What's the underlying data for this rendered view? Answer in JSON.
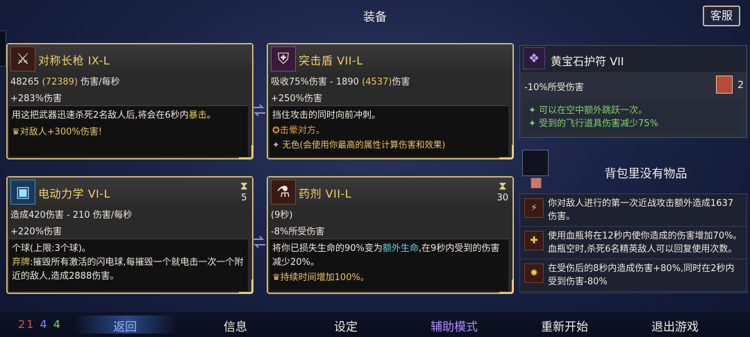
{
  "header": {
    "title": "装备",
    "customer_service": "客服"
  },
  "cards": {
    "weapon": {
      "name": "对称长枪  IX-L",
      "stat1_value": "48265",
      "stat1_paren": "(72389)",
      "stat1_unit": "伤害/每秒",
      "stat2": "+283%伤害",
      "desc_a": "用这把武器迅速杀死2名敌人后,将会在6秒内",
      "desc_highlight": "暴击",
      "desc_end": "。",
      "bonus": "对敌人+300%伤害!"
    },
    "shield": {
      "name": "突击盾  VII-L",
      "stat1_a": "吸收75%伤害  -  1890",
      "stat1_paren": "(4537)",
      "stat1_unit": "伤害",
      "stat2": "+250%伤害",
      "desc1": "挡住攻击的同时向前冲刺。",
      "desc2": "击晕对方。",
      "desc3": "无色(会使用你最高的属性计算伤害和效果)"
    },
    "skill1": {
      "name": "电动力学  VI-L",
      "cooldown": "5",
      "stat1": "造成420伤害  -  210 伤害/每秒",
      "stat2": "+220%伤害",
      "desc1": "个球(上限:3个球)。",
      "desc2_label": "弃牌",
      "desc2": ":摧毁所有激活的闪电球,每摧毁一个就电击一次一个附近的敌人,造成2888伤害。"
    },
    "skill2": {
      "name": "药剂  VII-L",
      "cooldown": "30",
      "stat1": "(9秒)",
      "stat2": "-8%所受伤害",
      "desc_a": "将你已损失生命的90%变为",
      "desc_highlight": "额外生命",
      "desc_b": ",在9秒内受到的伤害减少20%。",
      "bonus": "持续时间增加100%。"
    }
  },
  "amulet": {
    "name": "黄宝石护符  VII",
    "stat": "-10%所受伤害",
    "scroll_count": "2",
    "bonus1": "可以在空中额外跳跃一次。",
    "bonus2": "受到的飞行道具伤害减少75%"
  },
  "bag": {
    "empty_text": "背包里没有物品"
  },
  "effects": [
    {
      "text": "你对敌人进行的第一次近战攻击额外造成1637伤害。"
    },
    {
      "text": "使用血瓶将在12秒内使你造成的伤害增加70%。血瓶空时,杀死6名精英敌人可以回复使用次数。"
    },
    {
      "text": "在受伤后的8秒内造成伤害+80%,同时在2秒内受到伤害-80%"
    }
  ],
  "bottom": {
    "counts": {
      "red": "21",
      "purple": "4",
      "green": "4"
    },
    "nav": [
      "返回",
      "信息",
      "设定",
      "辅助模式",
      "重新开始",
      "退出游戏"
    ]
  },
  "colors": {
    "gold": "#e9c65f",
    "accent": "#b08cff",
    "border": "#cdb67c"
  }
}
